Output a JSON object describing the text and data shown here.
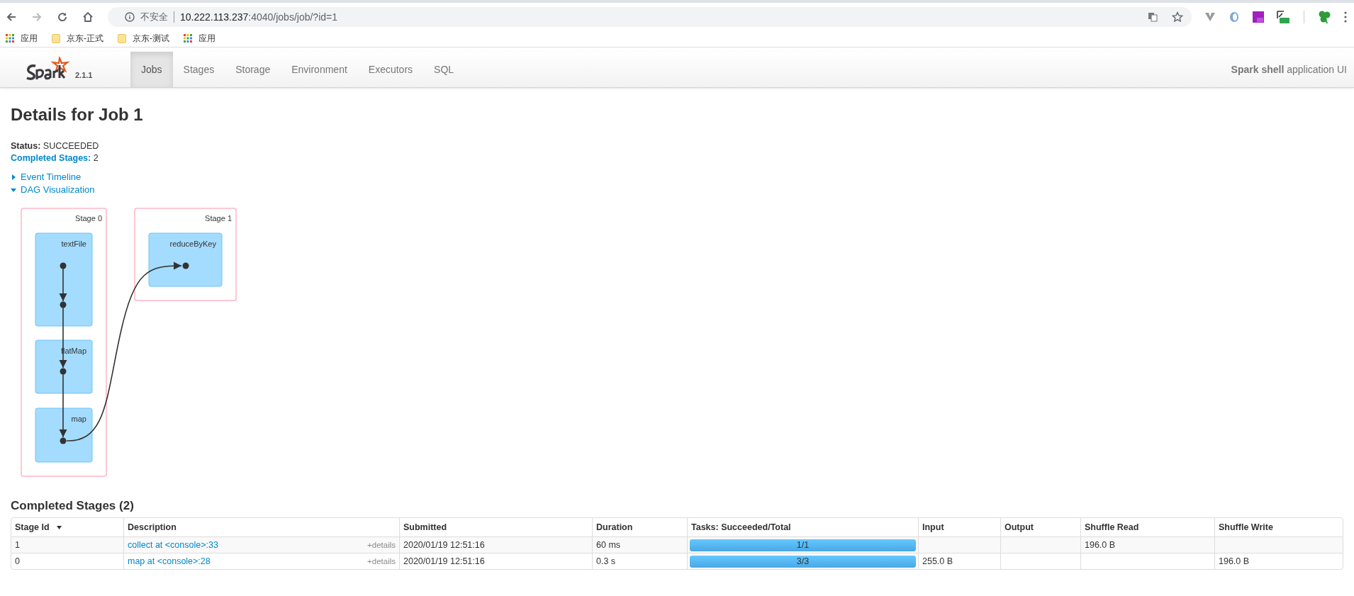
{
  "browser": {
    "security_label": "不安全",
    "url_host": "10.222.113.237",
    "url_path": ":4040/jobs/job/?id=1",
    "bookmarks": [
      {
        "kind": "apps",
        "label": "应用"
      },
      {
        "kind": "folder",
        "label": "京东-正式"
      },
      {
        "kind": "folder",
        "label": "京东-测试"
      },
      {
        "kind": "apps",
        "label": "应用"
      }
    ]
  },
  "navbar": {
    "version": "2.1.1",
    "tabs": [
      {
        "label": "Jobs",
        "selected": true
      },
      {
        "label": "Stages",
        "selected": false
      },
      {
        "label": "Storage",
        "selected": false
      },
      {
        "label": "Environment",
        "selected": false
      },
      {
        "label": "Executors",
        "selected": false
      },
      {
        "label": "SQL",
        "selected": false
      }
    ],
    "app_name": "Spark shell",
    "app_suffix": "application UI"
  },
  "page": {
    "title": "Details for Job 1",
    "status_label": "Status:",
    "status_value": "SUCCEEDED",
    "completed_label": "Completed Stages:",
    "completed_value": "2",
    "toggles": [
      {
        "label": "Event Timeline",
        "expanded": false
      },
      {
        "label": "DAG Visualization",
        "expanded": true
      }
    ]
  },
  "dag": {
    "stages": [
      {
        "label": "Stage 0",
        "nodes": [
          "textFile",
          "flatMap",
          "map"
        ]
      },
      {
        "label": "Stage 1",
        "nodes": [
          "reduceByKey"
        ]
      }
    ]
  },
  "table": {
    "title": "Completed Stages (2)",
    "columns": [
      "Stage Id",
      "Description",
      "Submitted",
      "Duration",
      "Tasks: Succeeded/Total",
      "Input",
      "Output",
      "Shuffle Read",
      "Shuffle Write"
    ],
    "rows": [
      {
        "stage_id": "1",
        "description": "collect at <console>:33",
        "details": "+details",
        "submitted": "2020/01/19 12:51:16",
        "duration": "60 ms",
        "tasks": "1/1",
        "level": 1,
        "input": "",
        "output": "",
        "shuffle_read": "196.0 B",
        "shuffle_write": ""
      },
      {
        "stage_id": "0",
        "description": "map at <console>:28",
        "details": "+details",
        "submitted": "2020/01/19 12:51:16",
        "duration": "0.3 s",
        "tasks": "3/3",
        "level": 1,
        "input": "255.0 B",
        "output": "",
        "shuffle_read": "",
        "shuffle_write": "196.0 B"
      }
    ]
  }
}
